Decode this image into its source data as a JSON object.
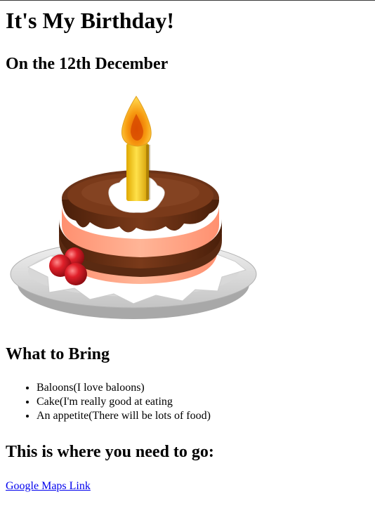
{
  "page": {
    "title": "It's My Birthday!",
    "subtitle": "On the 12th December"
  },
  "image": {
    "icon": "birthday-cake-icon"
  },
  "bring": {
    "heading": "What to Bring",
    "items": [
      "Baloons(I love baloons)",
      "Cake(I'm really good at eating",
      "An appetite(There will be lots of food)"
    ]
  },
  "location": {
    "heading": "This is where you need to go:",
    "link_text": "Google Maps Link"
  },
  "colors": {
    "link": "#0000ee",
    "chocolate": "#5a2a12",
    "cake_sponge": "#ff9f7a",
    "candle": "#f2c200",
    "flame": "#f08a00",
    "cherry": "#d0202a",
    "plate": "#cfcfcf"
  }
}
